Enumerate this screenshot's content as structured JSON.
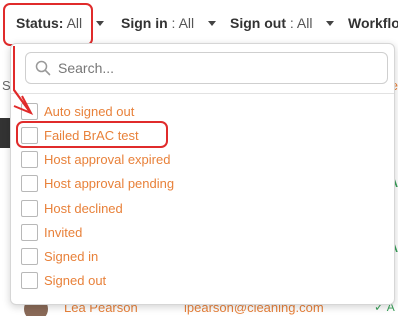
{
  "filters": {
    "status": {
      "label": "Status:",
      "value": "All"
    },
    "sign_in": {
      "label": "Sign in",
      "sep": " : ",
      "value": "All"
    },
    "sign_out": {
      "label": "Sign out",
      "sep": " : ",
      "value": "All"
    },
    "workflow": {
      "label": "Workflow"
    }
  },
  "search": {
    "placeholder": "Search..."
  },
  "status_options": [
    {
      "label": "Auto signed out",
      "checked": false
    },
    {
      "label": "Failed BrAC test",
      "checked": false
    },
    {
      "label": "Host approval expired",
      "checked": false
    },
    {
      "label": "Host approval pending",
      "checked": false
    },
    {
      "label": "Host declined",
      "checked": false
    },
    {
      "label": "Invited",
      "checked": false
    },
    {
      "label": "Signed in",
      "checked": false
    },
    {
      "label": "Signed out",
      "checked": false
    }
  ],
  "background": {
    "col_letter": "S",
    "right_letter": "e",
    "status_fragment": "A",
    "row": {
      "name": "Lea Pearson",
      "email": "lpearson@cleaning.com",
      "check": "✓ A"
    }
  },
  "annotation": {
    "highlight_color": "#e02b2b"
  },
  "colors": {
    "accent": "#e8813a",
    "ok": "#3aa05a"
  }
}
